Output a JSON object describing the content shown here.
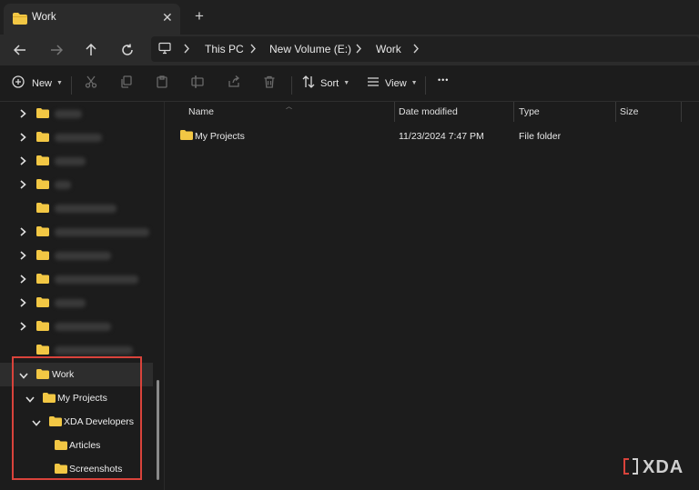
{
  "tab": {
    "title": "Work",
    "close_glyph": "✕",
    "new_tab_glyph": "+"
  },
  "breadcrumb": [
    "This PC",
    "New Volume (E:)",
    "Work"
  ],
  "commands": {
    "new_label": "New",
    "sort_label": "Sort",
    "view_label": "View",
    "more_glyph": "•••"
  },
  "sidebar": {
    "tree": [
      {
        "label": "Work",
        "expanded": true
      },
      {
        "label": "My Projects",
        "expanded": true
      },
      {
        "label": "XDA Developers",
        "expanded": true
      },
      {
        "label": "Articles"
      },
      {
        "label": "Screenshots"
      }
    ]
  },
  "columns": {
    "name": "Name",
    "date": "Date modified",
    "type": "Type",
    "size": "Size"
  },
  "files": [
    {
      "name": "My Projects",
      "date": "11/23/2024 7:47 PM",
      "type": "File folder",
      "size": ""
    }
  ],
  "watermark": {
    "text": "XDA"
  },
  "colors": {
    "folder": "#f2c744",
    "highlight": "#d9433b",
    "background": "#1c1c1c"
  }
}
